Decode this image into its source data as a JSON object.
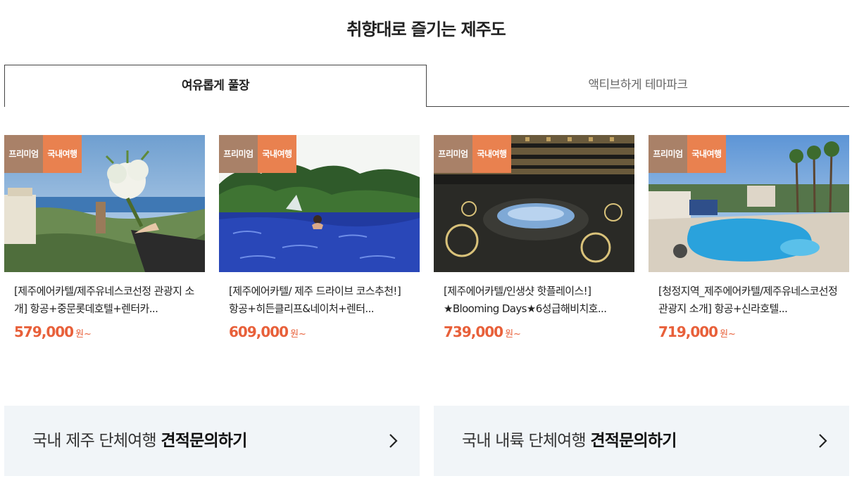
{
  "section": {
    "title": "취향대로 즐기는 제주도"
  },
  "tabs": [
    {
      "label": "여유롭게 풀장",
      "active": true
    },
    {
      "label": "액티브하게 테마파크",
      "active": false
    }
  ],
  "badges": {
    "premium": "프리미엄",
    "domestic": "국내여행"
  },
  "products": [
    {
      "title": "[제주에어카텔/제주유네스코선정 관광지 소개] 항공+중문롯데호텔+렌터카...",
      "price": "579,000",
      "unit": "원~"
    },
    {
      "title": "[제주에어카텔/ 제주 드라이브 코스추천!] 항공+히든클리프&네이처+렌터...",
      "price": "609,000",
      "unit": "원~"
    },
    {
      "title": "[제주에어카텔/인생샷 핫플레이스!] ★Blooming Days★6성급해비치호...",
      "price": "739,000",
      "unit": "원~"
    },
    {
      "title": "[청정지역_제주에어카텔/제주유네스코선정 관광지 소개] 항공+신라호텔...",
      "price": "719,000",
      "unit": "원~"
    }
  ],
  "inquiries": [
    {
      "prefix": "국내 제주 단체여행 ",
      "bold": "견적문의하기"
    },
    {
      "prefix": "국내 내륙 단체여행 ",
      "bold": "견적문의하기"
    }
  ],
  "colors": {
    "accent": "#e8603a",
    "badge_premium": "#a98168",
    "badge_domestic": "#e9814f",
    "inquiry_bg": "#f1f5f8"
  },
  "icons": {
    "inquiry_arrow": "chevron-right-icon"
  }
}
